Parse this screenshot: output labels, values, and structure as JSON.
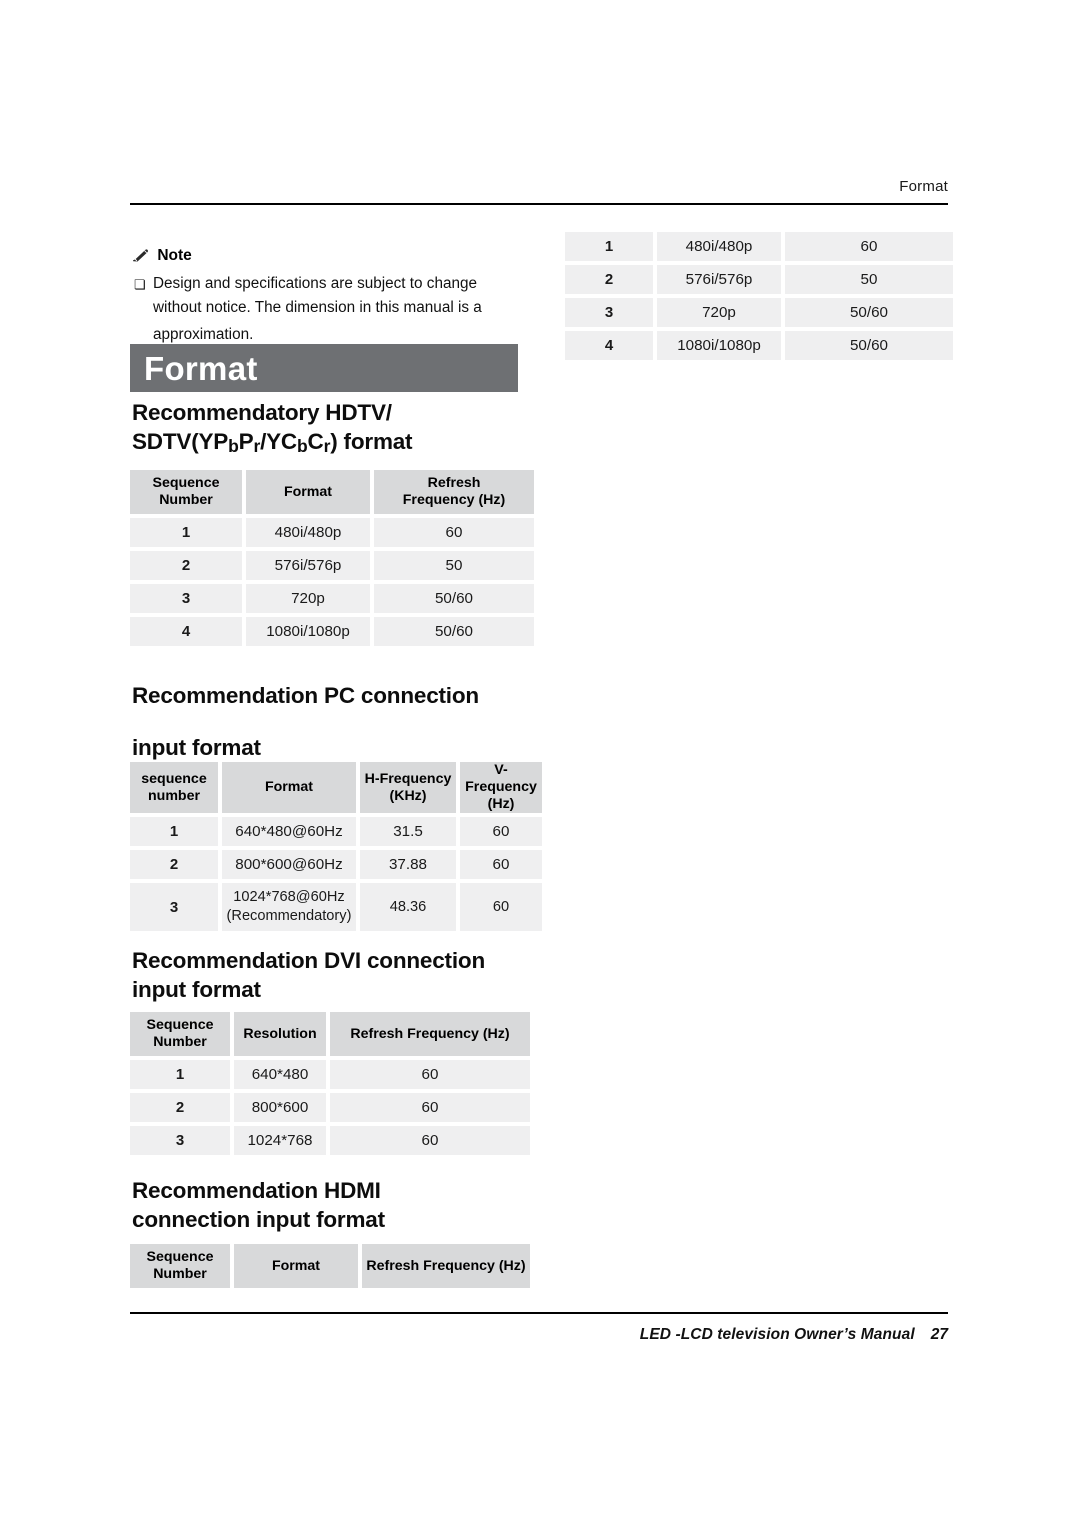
{
  "header": {
    "running_head": "Format"
  },
  "footer": {
    "manual_title": "LED -LCD television Owner’s Manual",
    "page_number": "27"
  },
  "note": {
    "icon": "pencil-icon",
    "title": "Note",
    "bullet_glyph": "❏",
    "line1": "Design and specifications are subject to change",
    "line2": "without notice. The dimension in this manual is a",
    "line3": "approximation."
  },
  "banner": {
    "label": "Format",
    "background": "#6e7073",
    "text_color": "#ffffff"
  },
  "sections": {
    "hdtv": {
      "heading_line1": "Recommendatory HDTV/",
      "heading_line2_pre": "SDTV(YP",
      "heading_sub1": "b",
      "heading_mid1": "P",
      "heading_sub2": "r",
      "heading_mid2": "/YC",
      "heading_sub3": "b",
      "heading_mid3": "C",
      "heading_sub4": "r",
      "heading_post": ") format"
    },
    "pc": {
      "heading_line1": "Recommendation PC connection",
      "heading_line2": "input format"
    },
    "dvi": {
      "heading_line1": "Recommendation DVI connection",
      "heading_line2": "input format"
    },
    "hdmi": {
      "heading_line1": "Recommendation HDMI",
      "heading_line2": "connection input format"
    }
  },
  "tables": {
    "hdtv": {
      "headers": [
        "Sequence\nNumber",
        "Format",
        "Refresh\nFrequency (Hz)"
      ],
      "header_lines": [
        [
          "Sequence",
          "Number"
        ],
        [
          "Format",
          ""
        ],
        [
          "Refresh",
          "Frequency (Hz)"
        ]
      ],
      "rows": [
        [
          "1",
          "480i/480p",
          "60"
        ],
        [
          "2",
          "576i/576p",
          "50"
        ],
        [
          "3",
          "720p",
          "50/60"
        ],
        [
          "4",
          "1080i/1080p",
          "50/60"
        ]
      ]
    },
    "pc": {
      "header_lines": [
        [
          "sequence",
          "number"
        ],
        [
          "Format",
          ""
        ],
        [
          "H-Frequency",
          "(KHz)"
        ],
        [
          "V-Frequency",
          "(Hz)"
        ]
      ],
      "rows": [
        [
          "1",
          "640*480@60Hz",
          "",
          "31.5",
          "60"
        ],
        [
          "2",
          "800*600@60Hz",
          "",
          "37.88",
          "60"
        ],
        [
          "3",
          "1024*768@60Hz",
          "(Recommendatory)",
          "48.36",
          "60"
        ]
      ]
    },
    "dvi": {
      "header_lines": [
        [
          "Sequence",
          "Number"
        ],
        [
          "Resolution",
          ""
        ],
        [
          "Refresh Frequency (Hz)",
          ""
        ]
      ],
      "rows": [
        [
          "1",
          "640*480",
          "60"
        ],
        [
          "2",
          "800*600",
          "60"
        ],
        [
          "3",
          "1024*768",
          "60"
        ]
      ]
    },
    "hdmi": {
      "header_lines": [
        [
          "Sequence",
          "Number"
        ],
        [
          "Format",
          ""
        ],
        [
          "Refresh Frequency (Hz)",
          ""
        ]
      ],
      "rows": []
    },
    "hdmi_continued": {
      "rows": [
        [
          "1",
          "480i/480p",
          "60"
        ],
        [
          "2",
          "576i/576p",
          "50"
        ],
        [
          "3",
          "720p",
          "50/60"
        ],
        [
          "4",
          "1080i/1080p",
          "50/60"
        ]
      ]
    }
  }
}
